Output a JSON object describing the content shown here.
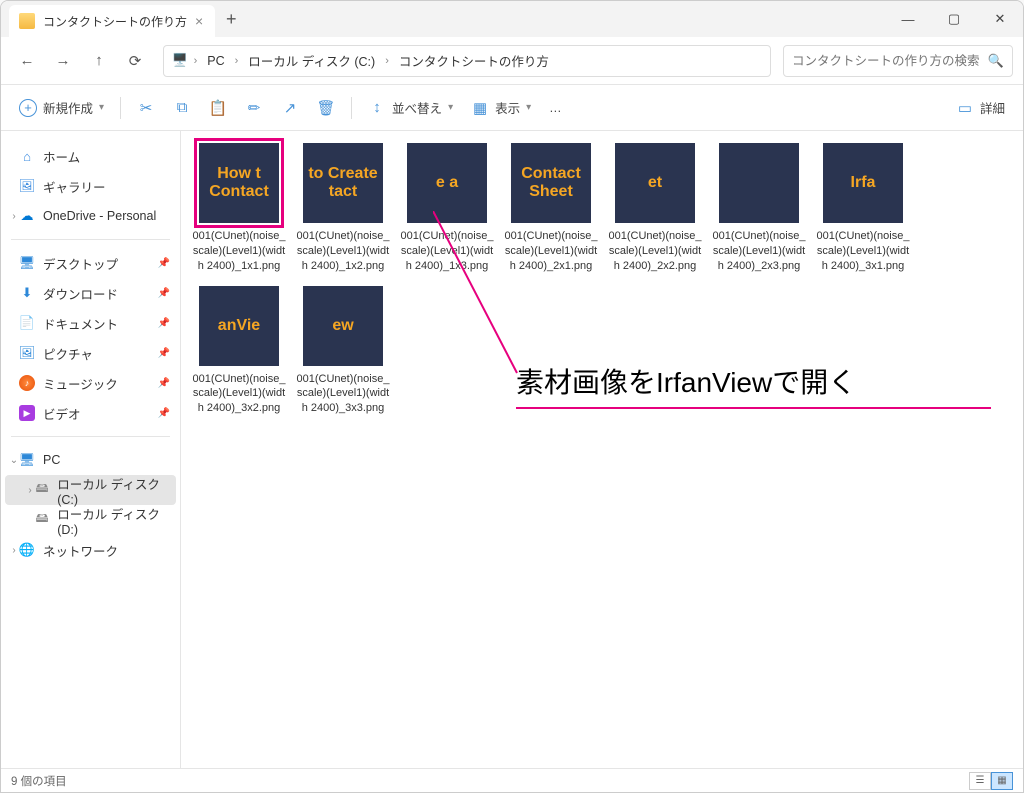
{
  "window_title": "コンタクトシートの作り方",
  "breadcrumb": [
    "PC",
    "ローカル ディスク (C:)",
    "コンタクトシートの作り方"
  ],
  "search_placeholder": "コンタクトシートの作り方の検索",
  "commands": {
    "new": "新規作成",
    "sort": "並べ替え",
    "view": "表示",
    "details": "詳細"
  },
  "sidebar": {
    "home": "ホーム",
    "gallery": "ギャラリー",
    "onedrive": "OneDrive - Personal",
    "desktop": "デスクトップ",
    "downloads": "ダウンロード",
    "documents": "ドキュメント",
    "pictures": "ピクチャ",
    "music": "ミュージック",
    "videos": "ビデオ",
    "pc": "PC",
    "disk_c": "ローカル ディスク (C:)",
    "disk_d": "ローカル ディスク (D:)",
    "network": "ネットワーク"
  },
  "files": [
    {
      "name": "001(CUnet)(noise_scale)(Level1)(width 2400)_1x1.png",
      "thumb_text": "How t\nContact",
      "highlight": true
    },
    {
      "name": "001(CUnet)(noise_scale)(Level1)(width 2400)_1x2.png",
      "thumb_text": "to Create\ntact"
    },
    {
      "name": "001(CUnet)(noise_scale)(Level1)(width 2400)_1x3.png",
      "thumb_text": "e a"
    },
    {
      "name": "001(CUnet)(noise_scale)(Level1)(width 2400)_2x1.png",
      "thumb_text": "Contact\nSheet"
    },
    {
      "name": "001(CUnet)(noise_scale)(Level1)(width 2400)_2x2.png",
      "thumb_text": "et"
    },
    {
      "name": "001(CUnet)(noise_scale)(Level1)(width 2400)_2x3.png",
      "thumb_text": ""
    },
    {
      "name": "001(CUnet)(noise_scale)(Level1)(width 2400)_3x1.png",
      "thumb_text": "Irfa"
    },
    {
      "name": "001(CUnet)(noise_scale)(Level1)(width 2400)_3x2.png",
      "thumb_text": "anVie"
    },
    {
      "name": "001(CUnet)(noise_scale)(Level1)(width 2400)_3x3.png",
      "thumb_text": "ew"
    }
  ],
  "annotation": "素材画像をIrfanViewで開く",
  "status": "9 個の項目"
}
